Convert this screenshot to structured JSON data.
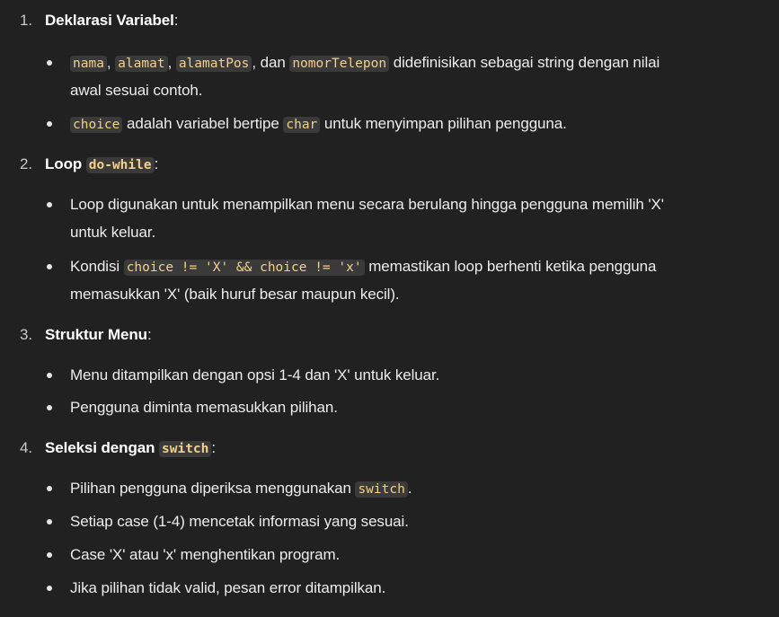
{
  "sections": [
    {
      "number": "1.",
      "title": "Deklarasi Variabel",
      "colon": ":",
      "items": [
        {
          "codes": [
            "nama",
            "alamat",
            "alamatPos",
            "nomorTelepon"
          ],
          "sep1": ",",
          "sep2": ",",
          "sep3": ", dan",
          "text_line1": "didefinisikan sebagai string dengan nilai",
          "text_line2": "awal sesuai contoh."
        },
        {
          "code1": "choice",
          "text1": "adalah variabel bertipe",
          "code2": "char",
          "text2": "untuk menyimpan pilihan pengguna."
        }
      ]
    },
    {
      "number": "2.",
      "title": "Loop",
      "title_code": "do-while",
      "colon": ":",
      "items": [
        {
          "line1": "Loop digunakan untuk menampilkan menu secara berulang hingga pengguna memilih 'X'",
          "line2": "untuk keluar."
        },
        {
          "text1": "Kondisi",
          "code": "choice != 'X' && choice != 'x'",
          "text2": "memastikan loop berhenti ketika pengguna",
          "line2": "memasukkan 'X' (baik huruf besar maupun kecil)."
        }
      ]
    },
    {
      "number": "3.",
      "title": "Struktur Menu",
      "colon": ":",
      "items": [
        {
          "text": "Menu ditampilkan dengan opsi 1-4 dan 'X' untuk keluar."
        },
        {
          "text": "Pengguna diminta memasukkan pilihan."
        }
      ]
    },
    {
      "number": "4.",
      "title": "Seleksi dengan",
      "title_code": "switch",
      "colon": ":",
      "items": [
        {
          "text": "Pilihan pengguna diperiksa menggunakan",
          "code": "switch",
          "end": "."
        },
        {
          "text": "Setiap case (1-4) mencetak informasi yang sesuai."
        },
        {
          "text": "Case 'X' atau 'x' menghentikan program."
        },
        {
          "text": "Jika pilihan tidak valid, pesan error ditampilkan."
        }
      ]
    }
  ]
}
